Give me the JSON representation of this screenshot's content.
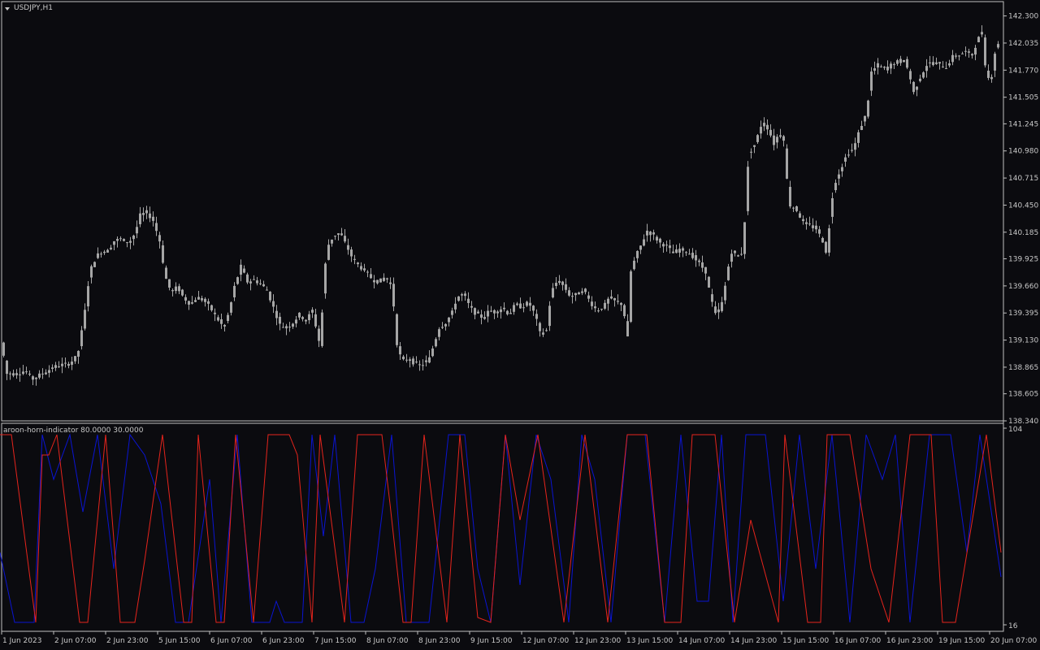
{
  "window": {
    "symbol_label": "USDJPY,H1",
    "dropdown_icon": "triangle-down-icon",
    "indicator_label": "aroon-horn-indicator 80.0000 30.0000"
  },
  "colors": {
    "background": "#0b0b0f",
    "frame": "#c0c0c0",
    "candle": "#a6a6a6",
    "aroon_up": "#0a14d2",
    "aroon_down": "#e6241c",
    "axis_text": "#c8c8c8"
  },
  "chart_data": [
    {
      "type": "candlestick",
      "symbol": "USDJPY",
      "timeframe": "H1",
      "ylim": [
        138.34,
        142.44
      ],
      "yticks": [
        "142.300",
        "142.035",
        "141.770",
        "141.505",
        "141.245",
        "140.980",
        "140.715",
        "140.450",
        "140.185",
        "139.925",
        "139.660",
        "139.395",
        "139.130",
        "138.865",
        "138.605",
        "138.340"
      ],
      "grid": false,
      "close_path": [
        [
          0,
          139.15
        ],
        [
          8,
          138.8
        ],
        [
          20,
          138.8
        ],
        [
          30,
          138.83
        ],
        [
          40,
          138.75
        ],
        [
          55,
          138.82
        ],
        [
          70,
          138.88
        ],
        [
          85,
          138.9
        ],
        [
          95,
          138.98
        ],
        [
          103,
          139.35
        ],
        [
          110,
          139.8
        ],
        [
          118,
          139.95
        ],
        [
          125,
          140.0
        ],
        [
          132,
          140.0
        ],
        [
          140,
          140.1
        ],
        [
          148,
          140.12
        ],
        [
          158,
          140.08
        ],
        [
          166,
          140.18
        ],
        [
          172,
          140.35
        ],
        [
          180,
          140.38
        ],
        [
          188,
          140.3
        ],
        [
          196,
          140.1
        ],
        [
          203,
          139.75
        ],
        [
          210,
          139.6
        ],
        [
          218,
          139.65
        ],
        [
          225,
          139.55
        ],
        [
          234,
          139.48
        ],
        [
          242,
          139.55
        ],
        [
          250,
          139.52
        ],
        [
          258,
          139.45
        ],
        [
          266,
          139.35
        ],
        [
          275,
          139.25
        ],
        [
          282,
          139.42
        ],
        [
          288,
          139.65
        ],
        [
          296,
          139.85
        ],
        [
          304,
          139.7
        ],
        [
          312,
          139.72
        ],
        [
          320,
          139.68
        ],
        [
          328,
          139.62
        ],
        [
          336,
          139.45
        ],
        [
          344,
          139.28
        ],
        [
          352,
          139.25
        ],
        [
          360,
          139.3
        ],
        [
          368,
          139.38
        ],
        [
          376,
          139.32
        ],
        [
          384,
          139.42
        ],
        [
          390,
          139.2
        ],
        [
          394,
          139.05
        ],
        [
          398,
          139.75
        ],
        [
          403,
          140.05
        ],
        [
          410,
          140.15
        ],
        [
          418,
          140.18
        ],
        [
          426,
          140.05
        ],
        [
          434,
          139.92
        ],
        [
          442,
          139.85
        ],
        [
          450,
          139.8
        ],
        [
          458,
          139.72
        ],
        [
          466,
          139.7
        ],
        [
          474,
          139.75
        ],
        [
          482,
          139.65
        ],
        [
          488,
          139.1
        ],
        [
          494,
          138.92
        ],
        [
          502,
          138.95
        ],
        [
          510,
          138.9
        ],
        [
          518,
          138.88
        ],
        [
          528,
          138.95
        ],
        [
          534,
          139.1
        ],
        [
          540,
          139.25
        ],
        [
          548,
          139.3
        ],
        [
          556,
          139.4
        ],
        [
          562,
          139.55
        ],
        [
          570,
          139.58
        ],
        [
          578,
          139.45
        ],
        [
          586,
          139.38
        ],
        [
          594,
          139.35
        ],
        [
          602,
          139.42
        ],
        [
          610,
          139.4
        ],
        [
          618,
          139.45
        ],
        [
          626,
          139.38
        ],
        [
          634,
          139.48
        ],
        [
          642,
          139.45
        ],
        [
          650,
          139.5
        ],
        [
          658,
          139.38
        ],
        [
          664,
          139.2
        ],
        [
          672,
          139.22
        ],
        [
          678,
          139.6
        ],
        [
          686,
          139.72
        ],
        [
          694,
          139.65
        ],
        [
          702,
          139.55
        ],
        [
          710,
          139.58
        ],
        [
          718,
          139.62
        ],
        [
          726,
          139.5
        ],
        [
          734,
          139.42
        ],
        [
          742,
          139.45
        ],
        [
          750,
          139.55
        ],
        [
          758,
          139.5
        ],
        [
          766,
          139.48
        ],
        [
          772,
          139.15
        ],
        [
          776,
          139.8
        ],
        [
          782,
          139.95
        ],
        [
          788,
          140.05
        ],
        [
          796,
          140.2
        ],
        [
          804,
          140.15
        ],
        [
          812,
          140.08
        ],
        [
          820,
          140.05
        ],
        [
          828,
          139.98
        ],
        [
          836,
          140.02
        ],
        [
          844,
          140.0
        ],
        [
          852,
          139.95
        ],
        [
          860,
          139.88
        ],
        [
          868,
          139.8
        ],
        [
          874,
          139.55
        ],
        [
          880,
          139.38
        ],
        [
          887,
          139.45
        ],
        [
          893,
          139.7
        ],
        [
          899,
          140.0
        ],
        [
          907,
          139.95
        ],
        [
          913,
          139.98
        ],
        [
          917,
          140.4
        ],
        [
          921,
          140.95
        ],
        [
          929,
          141.05
        ],
        [
          937,
          141.25
        ],
        [
          945,
          141.2
        ],
        [
          952,
          141.05
        ],
        [
          958,
          141.15
        ],
        [
          964,
          141.1
        ],
        [
          968,
          140.7
        ],
        [
          972,
          140.45
        ],
        [
          980,
          140.4
        ],
        [
          988,
          140.28
        ],
        [
          996,
          140.25
        ],
        [
          1004,
          140.22
        ],
        [
          1012,
          140.1
        ],
        [
          1018,
          139.95
        ],
        [
          1021,
          140.35
        ],
        [
          1026,
          140.65
        ],
        [
          1034,
          140.8
        ],
        [
          1042,
          140.95
        ],
        [
          1050,
          141.0
        ],
        [
          1058,
          141.2
        ],
        [
          1066,
          141.35
        ],
        [
          1072,
          141.75
        ],
        [
          1080,
          141.82
        ],
        [
          1088,
          141.78
        ],
        [
          1096,
          141.82
        ],
        [
          1104,
          141.85
        ],
        [
          1112,
          141.88
        ],
        [
          1118,
          141.75
        ],
        [
          1124,
          141.55
        ],
        [
          1132,
          141.7
        ],
        [
          1140,
          141.82
        ],
        [
          1148,
          141.85
        ],
        [
          1156,
          141.82
        ],
        [
          1164,
          141.8
        ],
        [
          1172,
          141.9
        ],
        [
          1180,
          141.92
        ],
        [
          1188,
          141.95
        ],
        [
          1196,
          141.92
        ],
        [
          1202,
          142.05
        ],
        [
          1208,
          142.15
        ],
        [
          1214,
          141.68
        ],
        [
          1220,
          141.72
        ],
        [
          1226,
          142.05
        ],
        [
          1232,
          141.95
        ]
      ]
    },
    {
      "type": "line",
      "ylim": [
        16,
        104
      ],
      "yticks": [
        "104",
        "16"
      ],
      "series": [
        {
          "color": "#0a14d2",
          "path": [
            [
              0,
              680
            ],
            [
              18,
              766
            ],
            [
              42,
              766
            ],
            [
              52,
              535
            ],
            [
              66,
              590
            ],
            [
              86,
              535
            ],
            [
              102,
              630
            ],
            [
              120,
              535
            ],
            [
              140,
              700
            ],
            [
              160,
              535
            ],
            [
              178,
              560
            ],
            [
              198,
              620
            ],
            [
              216,
              766
            ],
            [
              232,
              766
            ],
            [
              258,
              590
            ],
            [
              272,
              766
            ],
            [
              292,
              535
            ],
            [
              310,
              766
            ],
            [
              318,
              766
            ],
            [
              332,
              766
            ],
            [
              340,
              740
            ],
            [
              350,
              766
            ],
            [
              372,
              766
            ],
            [
              384,
              535
            ],
            [
              398,
              660
            ],
            [
              412,
              535
            ],
            [
              432,
              766
            ],
            [
              448,
              766
            ],
            [
              462,
              700
            ],
            [
              482,
              535
            ],
            [
              500,
              766
            ],
            [
              528,
              766
            ],
            [
              552,
              535
            ],
            [
              572,
              535
            ],
            [
              588,
              700
            ],
            [
              604,
              766
            ],
            [
              622,
              535
            ],
            [
              640,
              720
            ],
            [
              660,
              535
            ],
            [
              678,
              590
            ],
            [
              700,
              766
            ],
            [
              716,
              535
            ],
            [
              732,
              590
            ],
            [
              752,
              766
            ],
            [
              772,
              535
            ],
            [
              794,
              535
            ],
            [
              818,
              766
            ],
            [
              838,
              535
            ],
            [
              858,
              740
            ],
            [
              872,
              740
            ],
            [
              888,
              535
            ],
            [
              902,
              766
            ],
            [
              918,
              535
            ],
            [
              942,
              535
            ],
            [
              964,
              740
            ],
            [
              984,
              535
            ],
            [
              1004,
              700
            ],
            [
              1024,
              535
            ],
            [
              1046,
              766
            ],
            [
              1066,
              535
            ],
            [
              1086,
              590
            ],
            [
              1102,
              535
            ],
            [
              1120,
              766
            ],
            [
              1144,
              535
            ],
            [
              1170,
              535
            ],
            [
              1190,
              680
            ],
            [
              1206,
              535
            ],
            [
              1232,
              710
            ]
          ]
        },
        {
          "color": "#e6241c",
          "path": [
            [
              0,
              535
            ],
            [
              14,
              535
            ],
            [
              44,
              766
            ],
            [
              52,
              560
            ],
            [
              60,
              560
            ],
            [
              70,
              535
            ],
            [
              98,
              766
            ],
            [
              108,
              766
            ],
            [
              130,
              535
            ],
            [
              148,
              766
            ],
            [
              166,
              766
            ],
            [
              178,
              690
            ],
            [
              200,
              535
            ],
            [
              226,
              766
            ],
            [
              236,
              766
            ],
            [
              244,
              535
            ],
            [
              266,
              766
            ],
            [
              276,
              766
            ],
            [
              290,
              535
            ],
            [
              312,
              766
            ],
            [
              330,
              535
            ],
            [
              356,
              535
            ],
            [
              366,
              560
            ],
            [
              384,
              766
            ],
            [
              394,
              535
            ],
            [
              424,
              766
            ],
            [
              440,
              535
            ],
            [
              470,
              535
            ],
            [
              480,
              620
            ],
            [
              496,
              766
            ],
            [
              506,
              766
            ],
            [
              522,
              535
            ],
            [
              550,
              766
            ],
            [
              566,
              535
            ],
            [
              588,
              760
            ],
            [
              604,
              766
            ],
            [
              622,
              535
            ],
            [
              640,
              640
            ],
            [
              662,
              535
            ],
            [
              694,
              766
            ],
            [
              720,
              535
            ],
            [
              748,
              766
            ],
            [
              772,
              535
            ],
            [
              796,
              535
            ],
            [
              818,
              766
            ],
            [
              838,
              766
            ],
            [
              852,
              535
            ],
            [
              880,
              535
            ],
            [
              904,
              766
            ],
            [
              924,
              640
            ],
            [
              958,
              766
            ],
            [
              966,
              535
            ],
            [
              994,
              766
            ],
            [
              1010,
              766
            ],
            [
              1018,
              535
            ],
            [
              1046,
              535
            ],
            [
              1072,
              700
            ],
            [
              1094,
              766
            ],
            [
              1120,
              535
            ],
            [
              1146,
              535
            ],
            [
              1160,
              766
            ],
            [
              1176,
              766
            ],
            [
              1214,
              535
            ],
            [
              1232,
              680
            ]
          ]
        }
      ]
    }
  ],
  "xaxis": {
    "labels": [
      "1 Jun 2023",
      "2 Jun 07:00",
      "2 Jun 23:00",
      "5 Jun 15:00",
      "6 Jun 07:00",
      "6 Jun 23:00",
      "7 Jun 15:00",
      "8 Jun 07:00",
      "8 Jun 23:00",
      "9 Jun 15:00",
      "12 Jun 07:00",
      "12 Jun 23:00",
      "13 Jun 15:00",
      "14 Jun 07:00",
      "14 Jun 23:00",
      "15 Jun 15:00",
      "16 Jun 07:00",
      "16 Jun 23:00",
      "19 Jun 15:00",
      "20 Jun 07:00"
    ]
  }
}
